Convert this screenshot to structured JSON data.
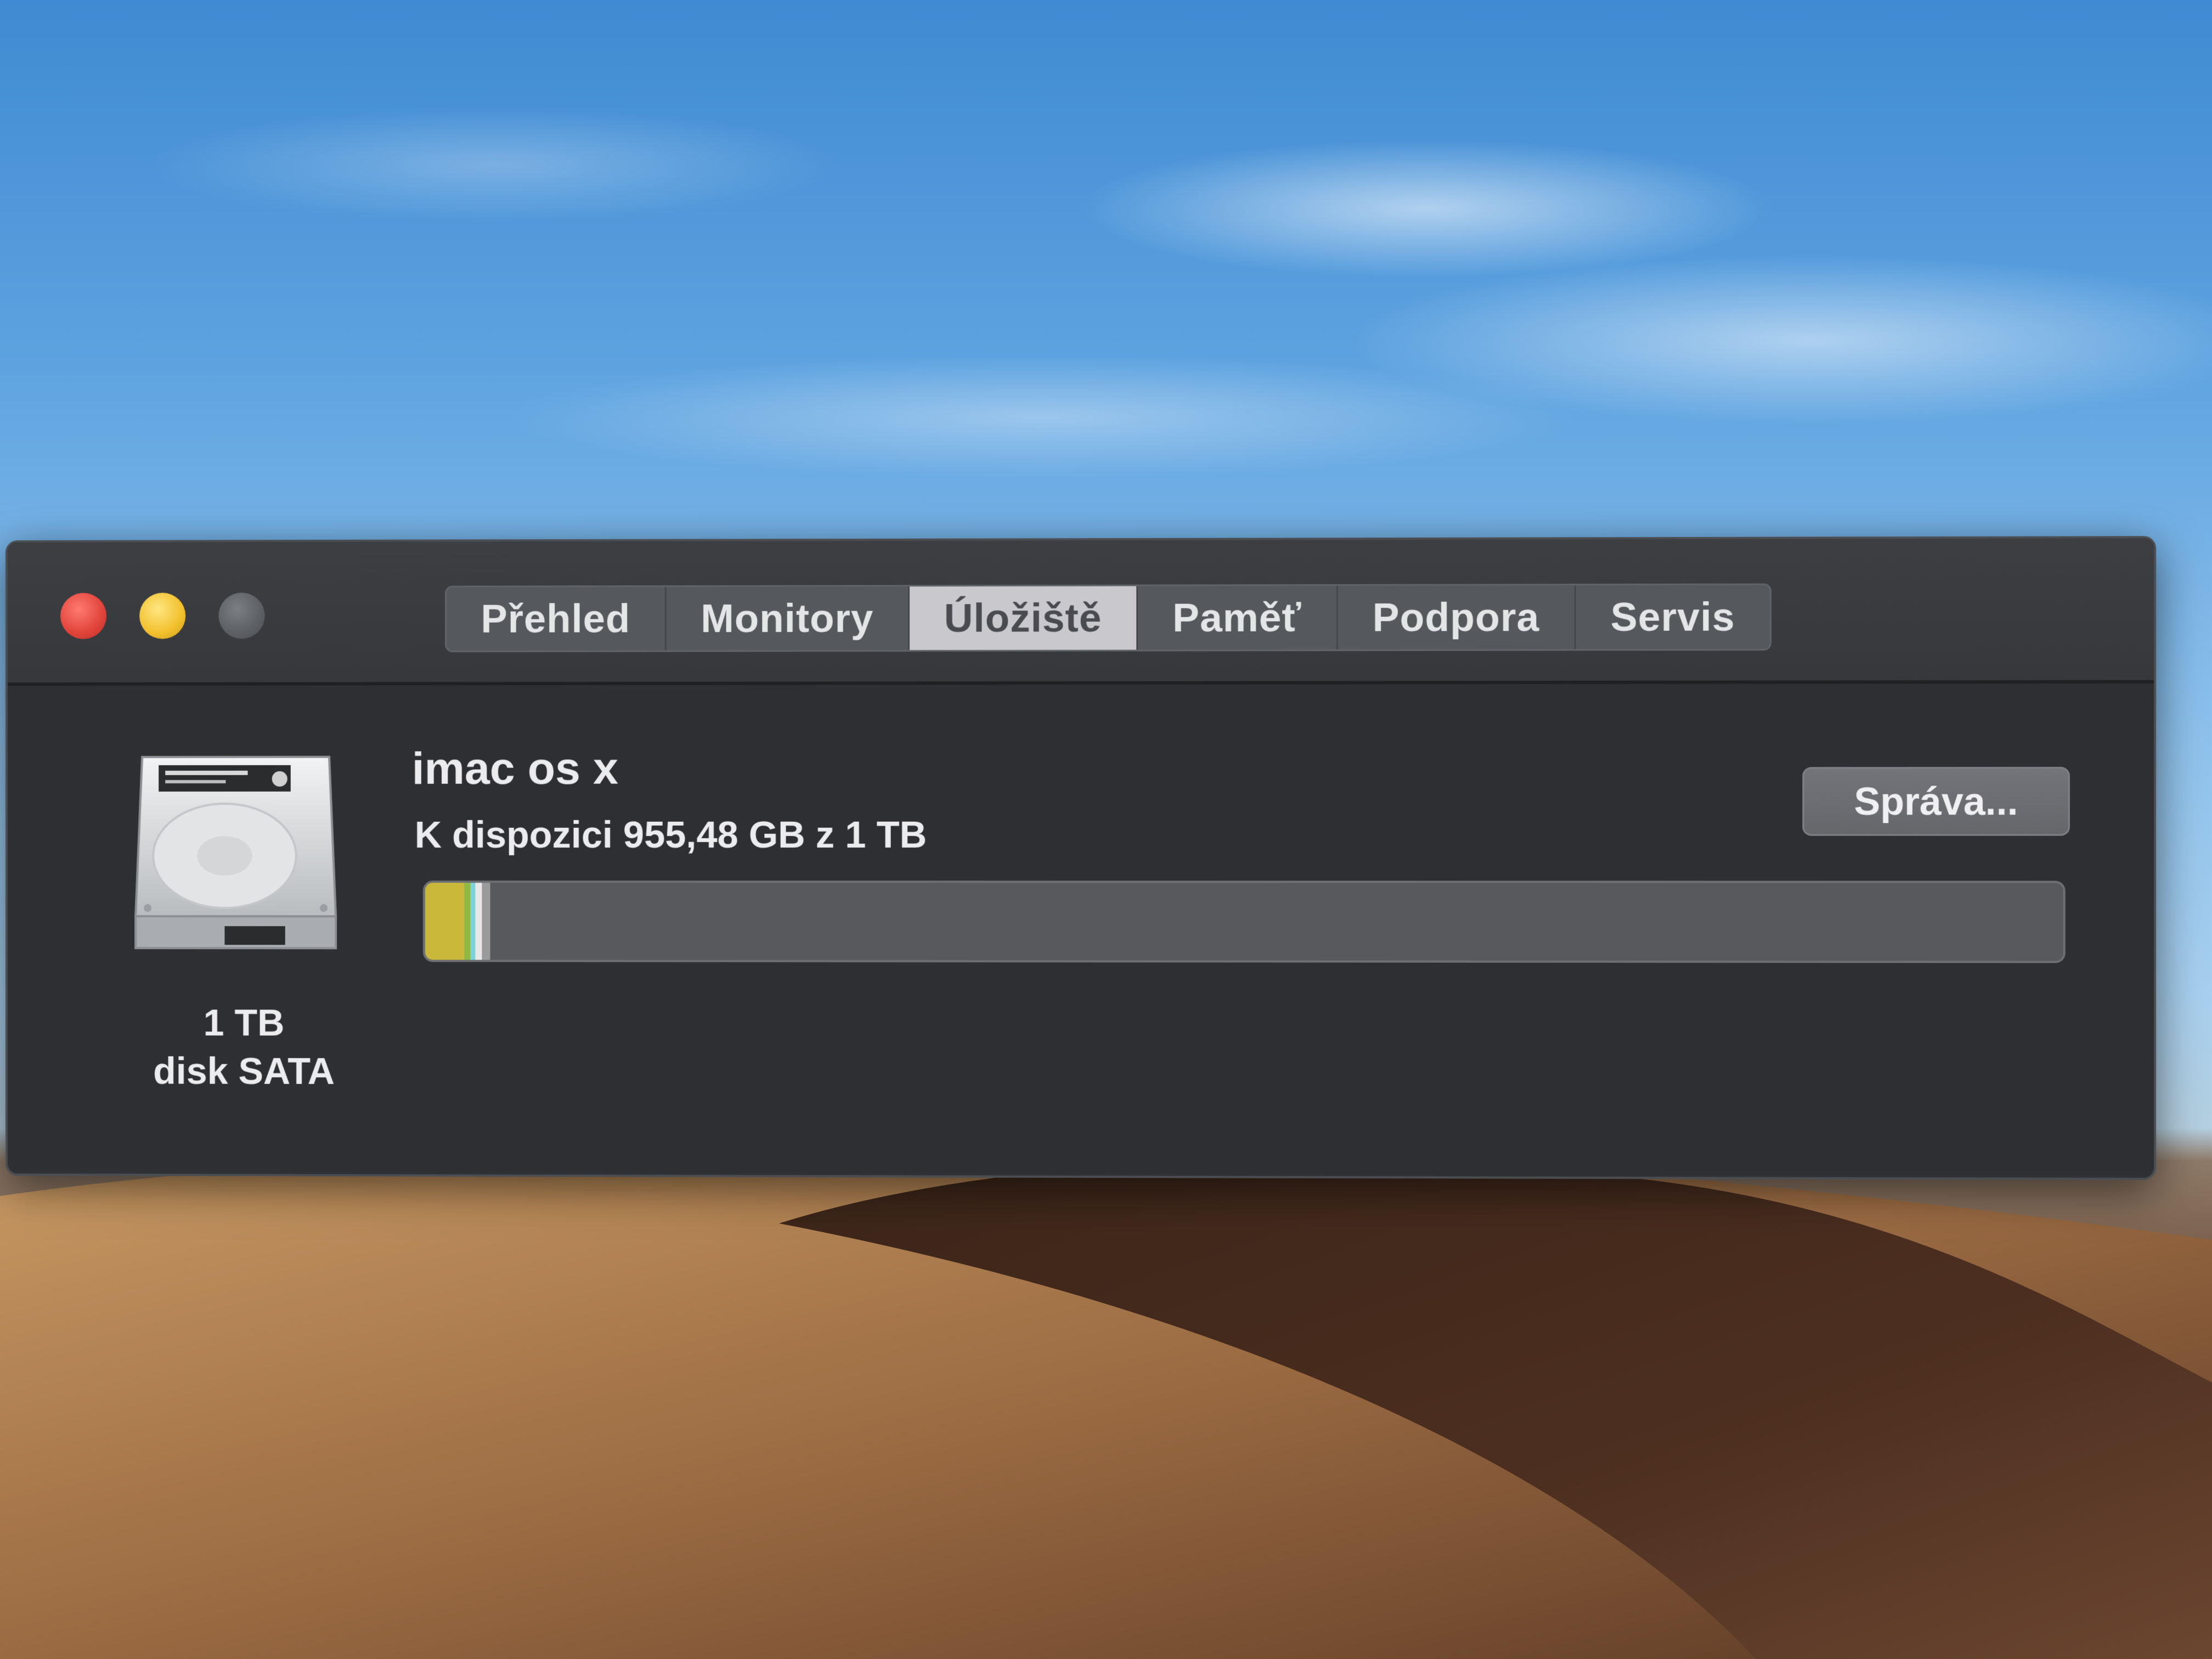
{
  "window": {
    "controls": [
      "close",
      "minimize",
      "zoom"
    ],
    "tabs": [
      {
        "label": "Přehled",
        "active": false
      },
      {
        "label": "Monitory",
        "active": false
      },
      {
        "label": "Úložiště",
        "active": true
      },
      {
        "label": "Paměť",
        "active": false
      },
      {
        "label": "Podpora",
        "active": false
      },
      {
        "label": "Servis",
        "active": false
      }
    ]
  },
  "storage": {
    "drive_icon": "hard-drive-icon",
    "drive_capacity": "1 TB",
    "drive_type": "disk SATA",
    "volume_name": "imac os x",
    "available_text": "K dispozici 955,48 GB z 1 TB",
    "manage_label": "Správa...",
    "usage_segments": [
      {
        "color": "#c9b83a",
        "fraction": 0.024
      },
      {
        "color": "#8fb845",
        "fraction": 0.004
      },
      {
        "color": "#7dd2d8",
        "fraction": 0.003
      },
      {
        "color": "#e8e8e8",
        "fraction": 0.004
      },
      {
        "color": "#9a9a9a",
        "fraction": 0.005
      }
    ],
    "free_color": "#58595d"
  },
  "colors": {
    "window_bg": "#2f3134",
    "active_tab": "#c9c8cc",
    "close": "#e0433a",
    "minimize": "#f2c02d",
    "zoom_disabled": "#5c5f63"
  }
}
